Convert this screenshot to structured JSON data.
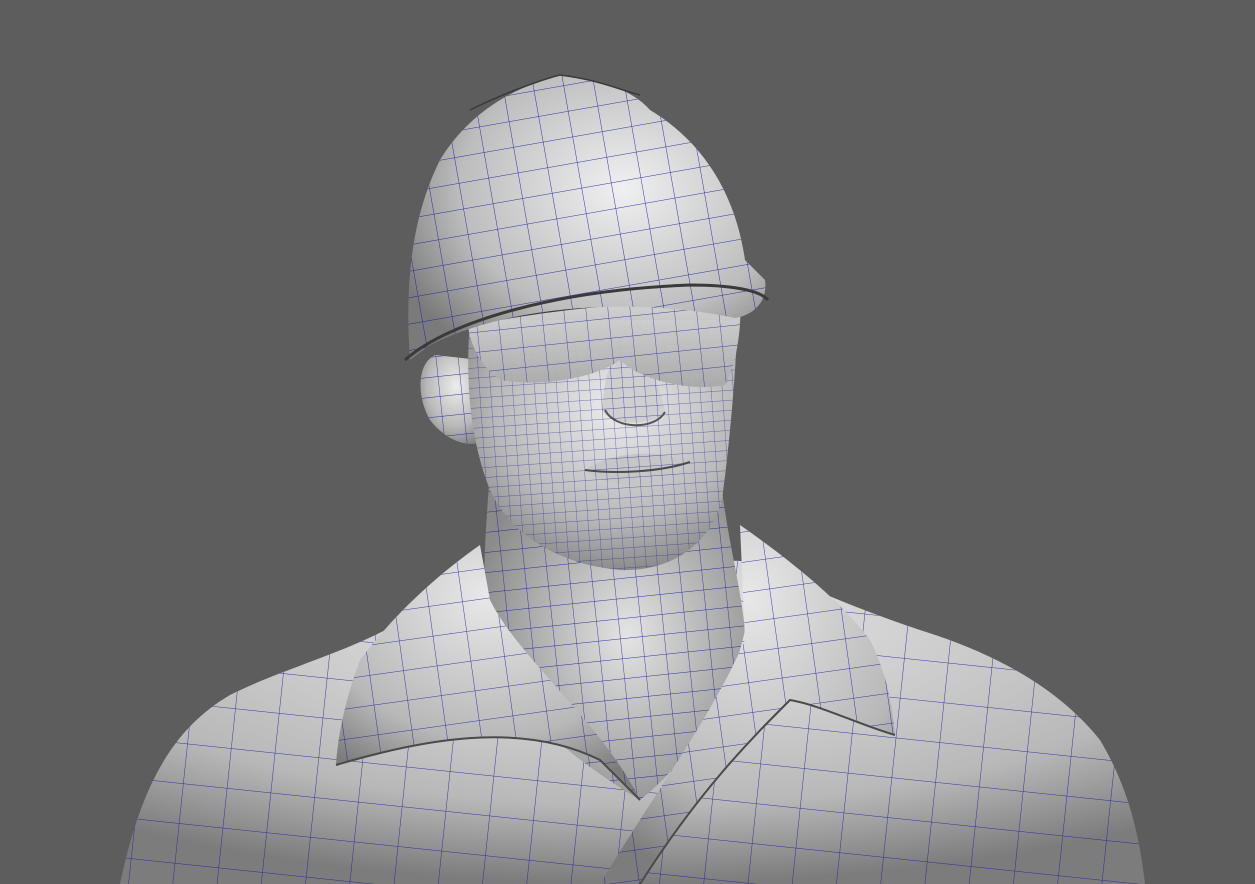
{
  "viewport": {
    "background": "#5d5d5d",
    "mesh_color": "#1f1f9e",
    "surface_light": "#e9e9e9",
    "surface_dark": "#6f6f6f"
  },
  "subject": {
    "parts": [
      "hard-hat",
      "safety-glasses",
      "head",
      "ear",
      "nose",
      "lips",
      "neck",
      "shirt-collar",
      "shirt-torso"
    ]
  }
}
